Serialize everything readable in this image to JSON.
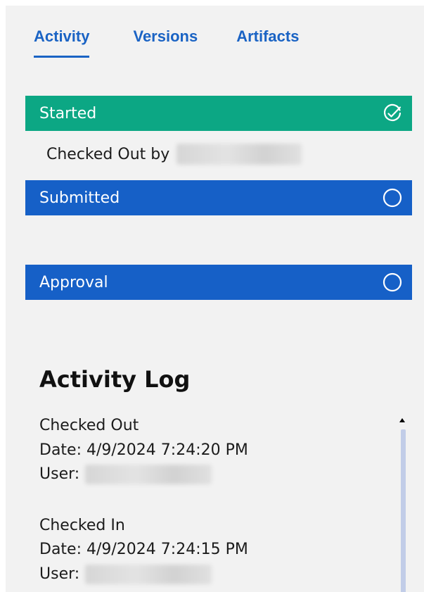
{
  "tabs": [
    {
      "label": "Activity",
      "active": true
    },
    {
      "label": "Versions",
      "active": false
    },
    {
      "label": "Artifacts",
      "active": false
    }
  ],
  "stages": {
    "started": {
      "label": "Started",
      "status_icon": "check-circle-icon",
      "color": "#0ca784"
    },
    "started_detail": {
      "label": "Checked Out by"
    },
    "submitted": {
      "label": "Submitted",
      "status_icon": "empty-circle-icon",
      "color": "#1660c7"
    },
    "approval": {
      "label": "Approval",
      "status_icon": "empty-circle-icon",
      "color": "#1660c7"
    }
  },
  "activity_log": {
    "title": "Activity Log",
    "entries": [
      {
        "action": "Checked Out",
        "date": "Date: 4/9/2024 7:24:20 PM",
        "user_label": "User:"
      },
      {
        "action": "Checked In",
        "date": "Date: 4/9/2024 7:24:15 PM",
        "user_label": "User:"
      }
    ]
  },
  "colors": {
    "accent": "#1a63c4",
    "panel_background": "#f2f2f2",
    "scroll_thumb": "#c2cde8"
  }
}
